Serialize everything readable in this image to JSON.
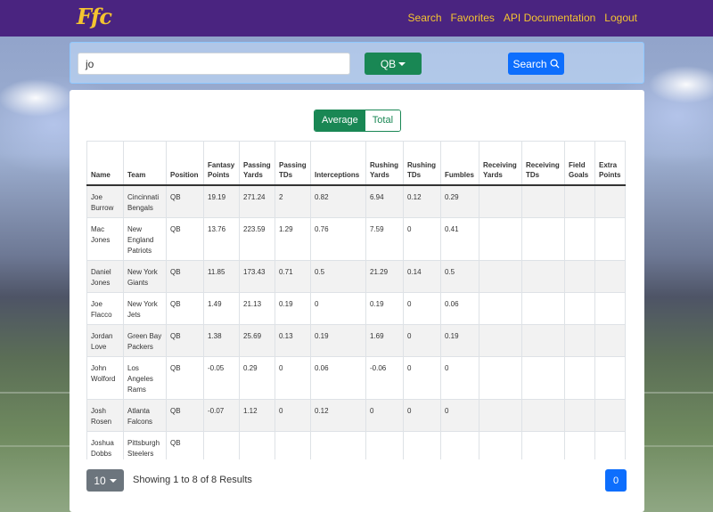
{
  "nav": {
    "brand": "Ffc",
    "links": [
      "Search",
      "Favorites",
      "API Documentation",
      "Logout"
    ]
  },
  "search": {
    "query": "jo",
    "position": "QB",
    "button_label": "Search"
  },
  "stats_toggle": {
    "average_label": "Average",
    "total_label": "Total",
    "selected": "Average"
  },
  "table": {
    "headers": [
      "Name",
      "Team",
      "Position",
      "Fantasy Points",
      "Passing Yards",
      "Passing TDs",
      "Interceptions",
      "Rushing Yards",
      "Rushing TDs",
      "Fumbles",
      "Receiving Yards",
      "Receiving TDs",
      "Field Goals",
      "Extra Points"
    ],
    "rows": [
      [
        "Joe Burrow",
        "Cincinnati Bengals",
        "QB",
        "19.19",
        "271.24",
        "2",
        "0.82",
        "6.94",
        "0.12",
        "0.29",
        "",
        "",
        "",
        ""
      ],
      [
        "Mac Jones",
        "New England Patriots",
        "QB",
        "13.76",
        "223.59",
        "1.29",
        "0.76",
        "7.59",
        "0",
        "0.41",
        "",
        "",
        "",
        ""
      ],
      [
        "Daniel Jones",
        "New York Giants",
        "QB",
        "11.85",
        "173.43",
        "0.71",
        "0.5",
        "21.29",
        "0.14",
        "0.5",
        "",
        "",
        "",
        ""
      ],
      [
        "Joe Flacco",
        "New York Jets",
        "QB",
        "1.49",
        "21.13",
        "0.19",
        "0",
        "0.19",
        "0",
        "0.06",
        "",
        "",
        "",
        ""
      ],
      [
        "Jordan Love",
        "Green Bay Packers",
        "QB",
        "1.38",
        "25.69",
        "0.13",
        "0.19",
        "1.69",
        "0",
        "0.19",
        "",
        "",
        "",
        ""
      ],
      [
        "John Wolford",
        "Los Angeles Rams",
        "QB",
        "-0.05",
        "0.29",
        "0",
        "0.06",
        "-0.06",
        "0",
        "0",
        "",
        "",
        "",
        ""
      ],
      [
        "Josh Rosen",
        "Atlanta Falcons",
        "QB",
        "-0.07",
        "1.12",
        "0",
        "0.12",
        "0",
        "0",
        "0",
        "",
        "",
        "",
        ""
      ],
      [
        "Joshua Dobbs",
        "Pittsburgh Steelers",
        "QB",
        "",
        "",
        "",
        "",
        "",
        "",
        "",
        "",
        "",
        "",
        ""
      ]
    ]
  },
  "pagination": {
    "page_size": "10",
    "summary": "Showing 1 to 8 of 8 Results",
    "current_page": "0"
  },
  "colors": {
    "navbar": "#4a2480",
    "brand": "#f4c430",
    "primary": "#0d6efd",
    "success": "#198754",
    "secondary": "#6c757d"
  }
}
